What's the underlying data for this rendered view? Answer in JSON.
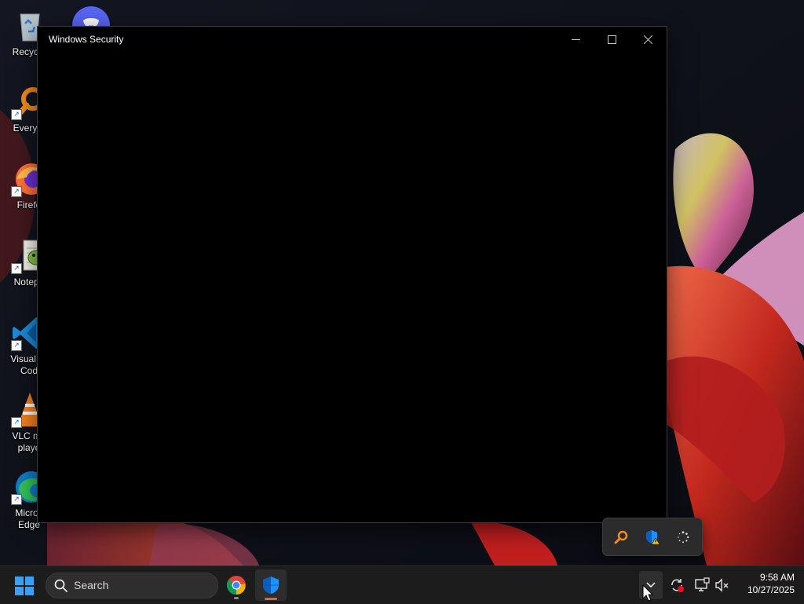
{
  "desktop": {
    "icons": [
      {
        "label": "Recycle",
        "icon": "recycle-bin-icon"
      },
      {
        "label": "Everyth",
        "icon": "everything-search-icon"
      },
      {
        "label": "Firefo",
        "icon": "firefox-icon"
      },
      {
        "label": "Notepa",
        "icon": "notepad-plus-plus-icon"
      },
      {
        "label": "Visual St\nCod",
        "icon": "vscode-icon"
      },
      {
        "label": "VLC me\nplaye",
        "icon": "vlc-icon"
      },
      {
        "label": "Micros\nEdge",
        "icon": "edge-icon"
      }
    ],
    "top_icon": "discord-icon"
  },
  "window": {
    "title": "Windows Security",
    "controls": [
      "minimize",
      "maximize",
      "close"
    ]
  },
  "tray_flyout": {
    "icons": [
      "everything-search-icon",
      "windows-security-warning-icon",
      "loading-spinner-icon"
    ]
  },
  "taskbar": {
    "search_label": "Search",
    "pinned": [
      "chrome-icon",
      "windows-security-icon"
    ],
    "active_app": "Windows Security",
    "tray_icons": [
      "sync-error-icon",
      "display-projection-icon",
      "volume-muted-icon"
    ],
    "time": "9:58 AM",
    "date": "10/27/2025"
  },
  "colors": {
    "accent_orange": "#e0653a",
    "taskbar_bg": "#1c1c1c",
    "window_bg": "#000000",
    "windows_blue": "#1e90ff"
  }
}
